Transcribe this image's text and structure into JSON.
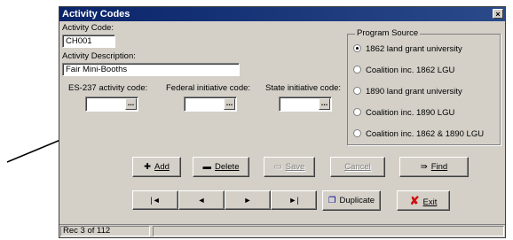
{
  "window": {
    "title": "Activity Codes",
    "close_label": "×"
  },
  "fields": {
    "activity_code_label": "Activity Code:",
    "activity_code_value": "CH001",
    "activity_description_label": "Activity Description:",
    "activity_description_value": "Fair Mini-Booths",
    "es237_label": "ES-237 activity code:",
    "federal_label": "Federal initiative code:",
    "state_label": "State initiative code:",
    "ellipsis": "..."
  },
  "program_source": {
    "title": "Program Source",
    "options": [
      {
        "label": "1862 land grant university",
        "selected": true
      },
      {
        "label": "Coalition inc. 1862 LGU",
        "selected": false
      },
      {
        "label": "1890 land grant university",
        "selected": false
      },
      {
        "label": "Coalition inc. 1890 LGU",
        "selected": false
      },
      {
        "label": "Coalition inc. 1862 & 1890 LGU",
        "selected": false
      }
    ]
  },
  "actions": {
    "add": "Add",
    "delete": "Delete",
    "save": "Save",
    "cancel": "Cancel",
    "find": "Find",
    "duplicate": "Duplicate",
    "exit": "Exit"
  },
  "navigation": {
    "first": "|◄",
    "prev": "◄",
    "next": "►",
    "last": "►|"
  },
  "status": {
    "record": "Rec 3 of 112"
  },
  "colors": {
    "titlebar": "#0a246a",
    "face": "#d4d0c8",
    "exit_icon": "#d01010"
  }
}
